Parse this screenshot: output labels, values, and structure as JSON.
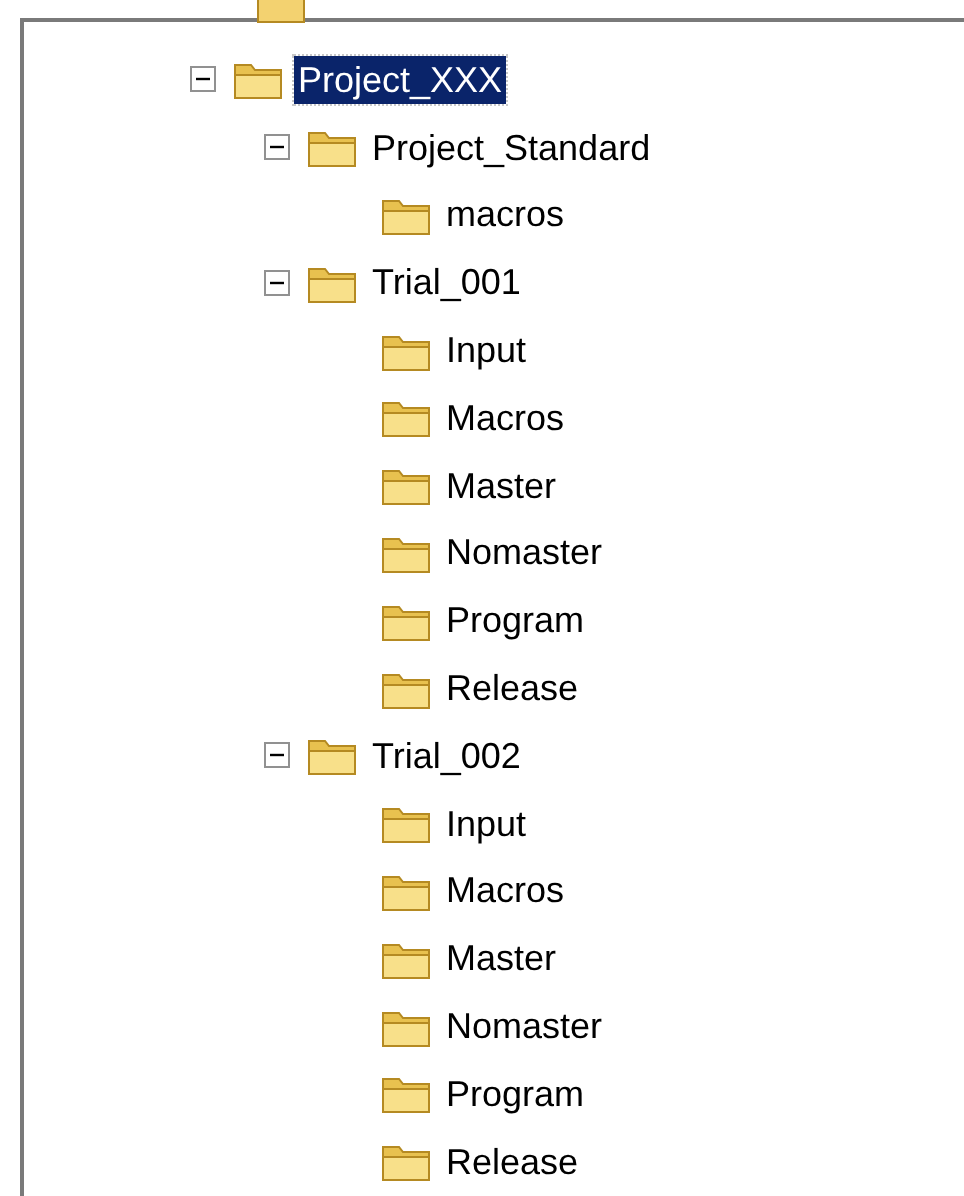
{
  "tree": [
    {
      "label": "Project_XXX",
      "expanded": true,
      "selected": true,
      "children": [
        {
          "label": "Project_Standard",
          "expanded": true,
          "selected": false,
          "children": [
            {
              "label": "macros",
              "selected": false
            }
          ]
        },
        {
          "label": "Trial_001",
          "expanded": true,
          "selected": false,
          "children": [
            {
              "label": "Input",
              "selected": false
            },
            {
              "label": "Macros",
              "selected": false
            },
            {
              "label": "Master",
              "selected": false
            },
            {
              "label": "Nomaster",
              "selected": false
            },
            {
              "label": "Program",
              "selected": false
            },
            {
              "label": "Release",
              "selected": false
            }
          ]
        },
        {
          "label": "Trial_002",
          "expanded": true,
          "selected": false,
          "children": [
            {
              "label": "Input",
              "selected": false
            },
            {
              "label": "Macros",
              "selected": false
            },
            {
              "label": "Master",
              "selected": false
            },
            {
              "label": "Nomaster",
              "selected": false
            },
            {
              "label": "Program",
              "selected": false
            },
            {
              "label": "Release",
              "selected": false
            }
          ]
        }
      ]
    }
  ]
}
